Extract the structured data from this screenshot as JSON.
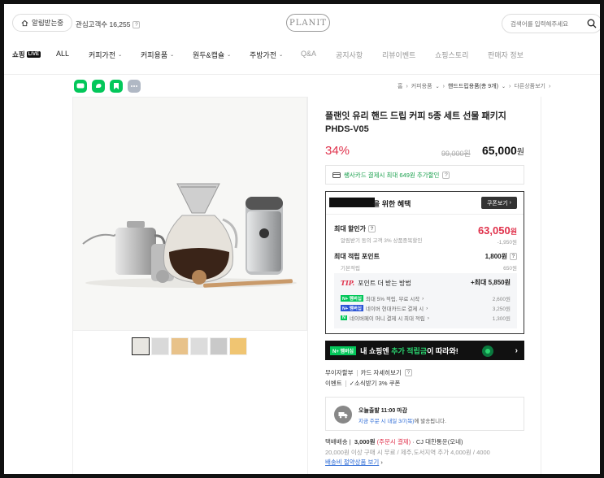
{
  "header": {
    "alarm_label": "알림받는중",
    "interest_label": "관심고객수 16,255",
    "logo_text": "PLANIT",
    "search_placeholder": "검색어를 입력해주세요"
  },
  "nav": {
    "shopping_live": "쇼핑",
    "live_badge": "LIVE",
    "items": [
      "ALL",
      "커피가전",
      "커피용품",
      "원두&캡슐",
      "주방가전",
      "Q&A",
      "공지사항",
      "리뷰이벤트",
      "쇼핑스토리",
      "판매자 정보"
    ]
  },
  "breadcrumb": {
    "home": "홈",
    "level1": "커피용품",
    "level2": "핸드드립용품(총 9개)",
    "next": "다른상품보기"
  },
  "product": {
    "title": "플랜잇 유리 핸드 드립 커피 5종 세트 선물 패키지 PHDS-V05",
    "discount": "34%",
    "original_price": "99,000원",
    "sale_price": "65,000",
    "sale_unit": "원"
  },
  "card_promo": "쌩사카드 결제시 최대 649원 추가할인",
  "benefit": {
    "title": "을 위한 혜택",
    "coupon_button": "쿠폰보기",
    "max_discount_label": "최대 할인가",
    "max_discount_value": "63,050",
    "max_discount_unit": "원",
    "alarm_sub": "알림받기 동의 고객 3% 상품중복할인",
    "alarm_sub_value": "-1,950원",
    "max_point_label": "최대 적립 포인트",
    "max_point_value": "1,800원",
    "basic_sub": "기본적립",
    "basic_sub_value": "650원",
    "tip_tag": "TIP.",
    "tip_title": "포인트 더 받는 방법",
    "tip_total": "+최대 5,850원",
    "tips": [
      {
        "badge": "N+ 멤버십",
        "text": "최대 5% 적립, 무료 시작",
        "amount": "2,600원"
      },
      {
        "badge": "N+ 멤버십",
        "text": "네이버 현대카드로 결제 시",
        "amount": "3,250원"
      },
      {
        "badge": "N",
        "text": "네이버페이 머니 결제 시 최대 적립",
        "amount": "1,300원"
      }
    ]
  },
  "banner": {
    "badge": "N+ 멤버십",
    "text_pre": "내 쇼핑엔 ",
    "text_hl": "추가 적립금",
    "text_post": "이 따라와!"
  },
  "misc": {
    "installment": "무이자할부",
    "card_detail": "카드 자세히보기",
    "event_label": "이벤트",
    "event_value": "✓소식받기 3% 쿠폰"
  },
  "delivery": {
    "title": "오늘출발 11:00 마감",
    "sub_blue": "지금 주문 시 내일 3/7(목)",
    "sub_rest": "에 발송됩니다."
  },
  "shipping": {
    "label": "택배배송",
    "price": "3,000원",
    "method": "(주문시 결제)",
    "carrier": "· CJ 대한통운(오네)",
    "condition": "20,000원 이상 구매 시 무료 / 제주,도서지역 추가 4,000원 / 4000",
    "save_link": "배송비 절약상품 보기"
  }
}
